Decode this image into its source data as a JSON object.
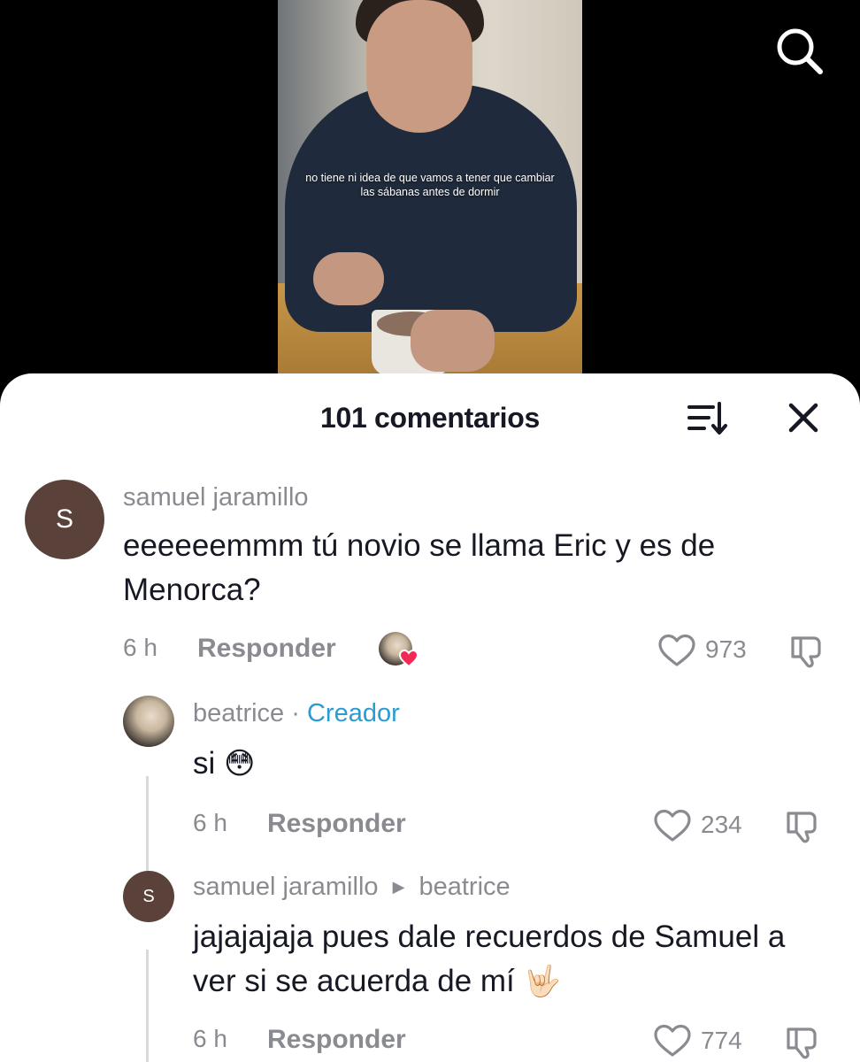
{
  "video": {
    "caption": "no tiene ni idea de que vamos a tener que cambiar las sábanas antes de dormir"
  },
  "header": {
    "title": "101 comentarios"
  },
  "comments": [
    {
      "avatar_letter": "S",
      "username": "samuel jaramillo",
      "text": "eeeeeemmm tú novio se llama Eric y es de Menorca?",
      "time": "6 h",
      "reply_label": "Responder",
      "likes": "973",
      "liked_by_creator": true
    },
    {
      "username": "beatrice",
      "separator": "·",
      "badge": "Creador",
      "text": "si",
      "emoji": "😳",
      "time": "6 h",
      "reply_label": "Responder",
      "likes": "234"
    },
    {
      "avatar_letter": "S",
      "username": "samuel jaramillo",
      "reply_to": "beatrice",
      "text": "jajajajaja pues dale recuerdos de Samuel a ver si se acuerda de mí",
      "emoji": "🤟🏻",
      "time": "6 h",
      "reply_label": "Responder",
      "likes": "774"
    }
  ],
  "colors": {
    "accent_creator": "#2a9bd3",
    "heart_red": "#f02c56",
    "avatar_brown": "#5a4139"
  },
  "icons": [
    "search-icon",
    "sort-icon",
    "close-icon",
    "heart-icon",
    "dislike-icon"
  ]
}
